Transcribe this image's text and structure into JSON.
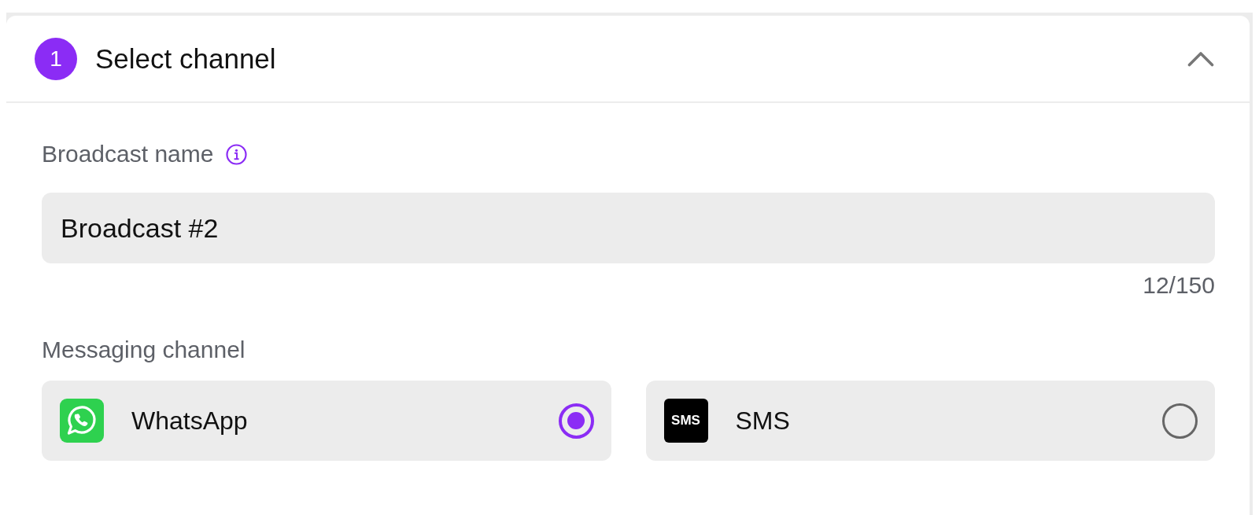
{
  "step": {
    "number": "1",
    "title": "Select channel",
    "expanded": true
  },
  "broadcast_name": {
    "label": "Broadcast name",
    "value": "Broadcast #2",
    "counter": "12/150"
  },
  "messaging_channel": {
    "label": "Messaging channel",
    "options": [
      {
        "kind": "whatsapp",
        "label": "WhatsApp",
        "selected": true
      },
      {
        "kind": "sms",
        "label": "SMS",
        "icon_text": "SMS",
        "selected": false
      }
    ]
  }
}
